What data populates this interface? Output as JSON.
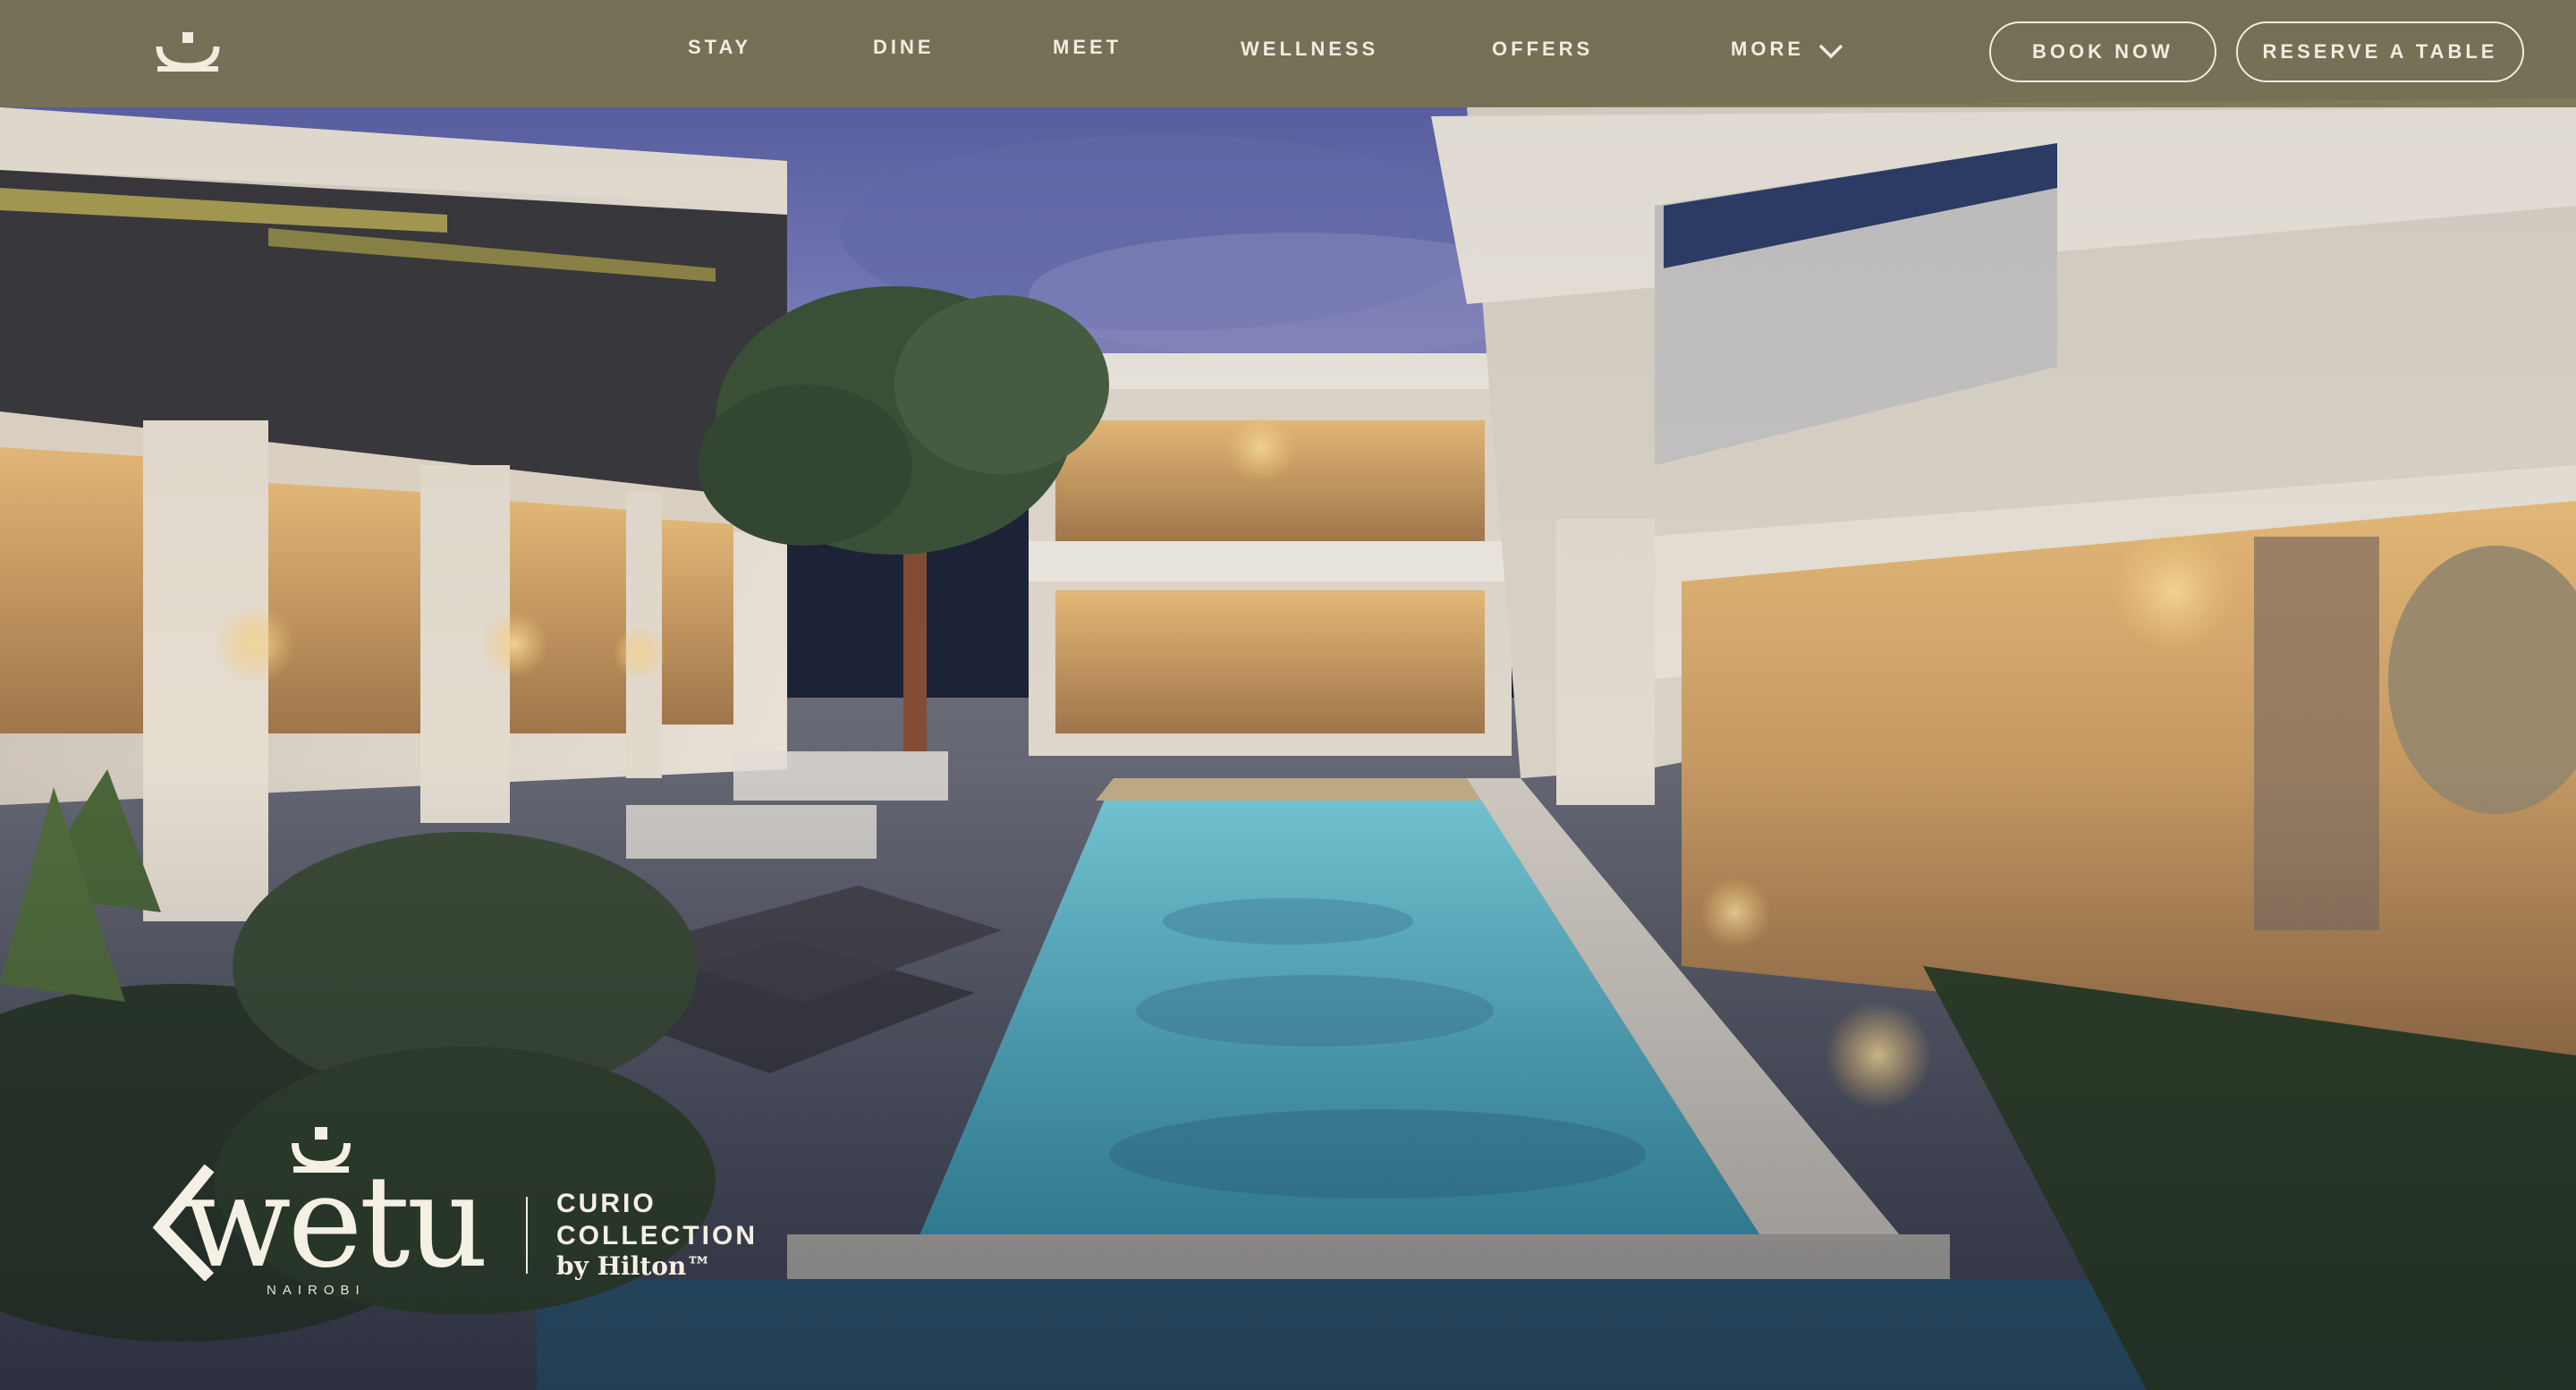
{
  "nav": {
    "links": [
      {
        "label": "STAY"
      },
      {
        "label": "DINE"
      },
      {
        "label": "MEET"
      },
      {
        "label": "WELLNESS"
      },
      {
        "label": "OFFERS"
      },
      {
        "label": "MORE"
      }
    ],
    "logo_icon": "kwetu-arc-icon",
    "more_icon": "chevron-down-icon",
    "book_now_label": "BOOK NOW",
    "reserve_table_label": "RESERVE A TABLE"
  },
  "brand": {
    "wordmark": "wetu",
    "location": "NAIROBI",
    "collection_line1": "CURIO",
    "collection_line2": "COLLECTION",
    "collection_line3": "by Hilton™"
  },
  "colors": {
    "navbar_bg": "#787250",
    "text_light": "#f1ece0",
    "sky": "#5b61a5",
    "pool": "#6fc6d8"
  }
}
